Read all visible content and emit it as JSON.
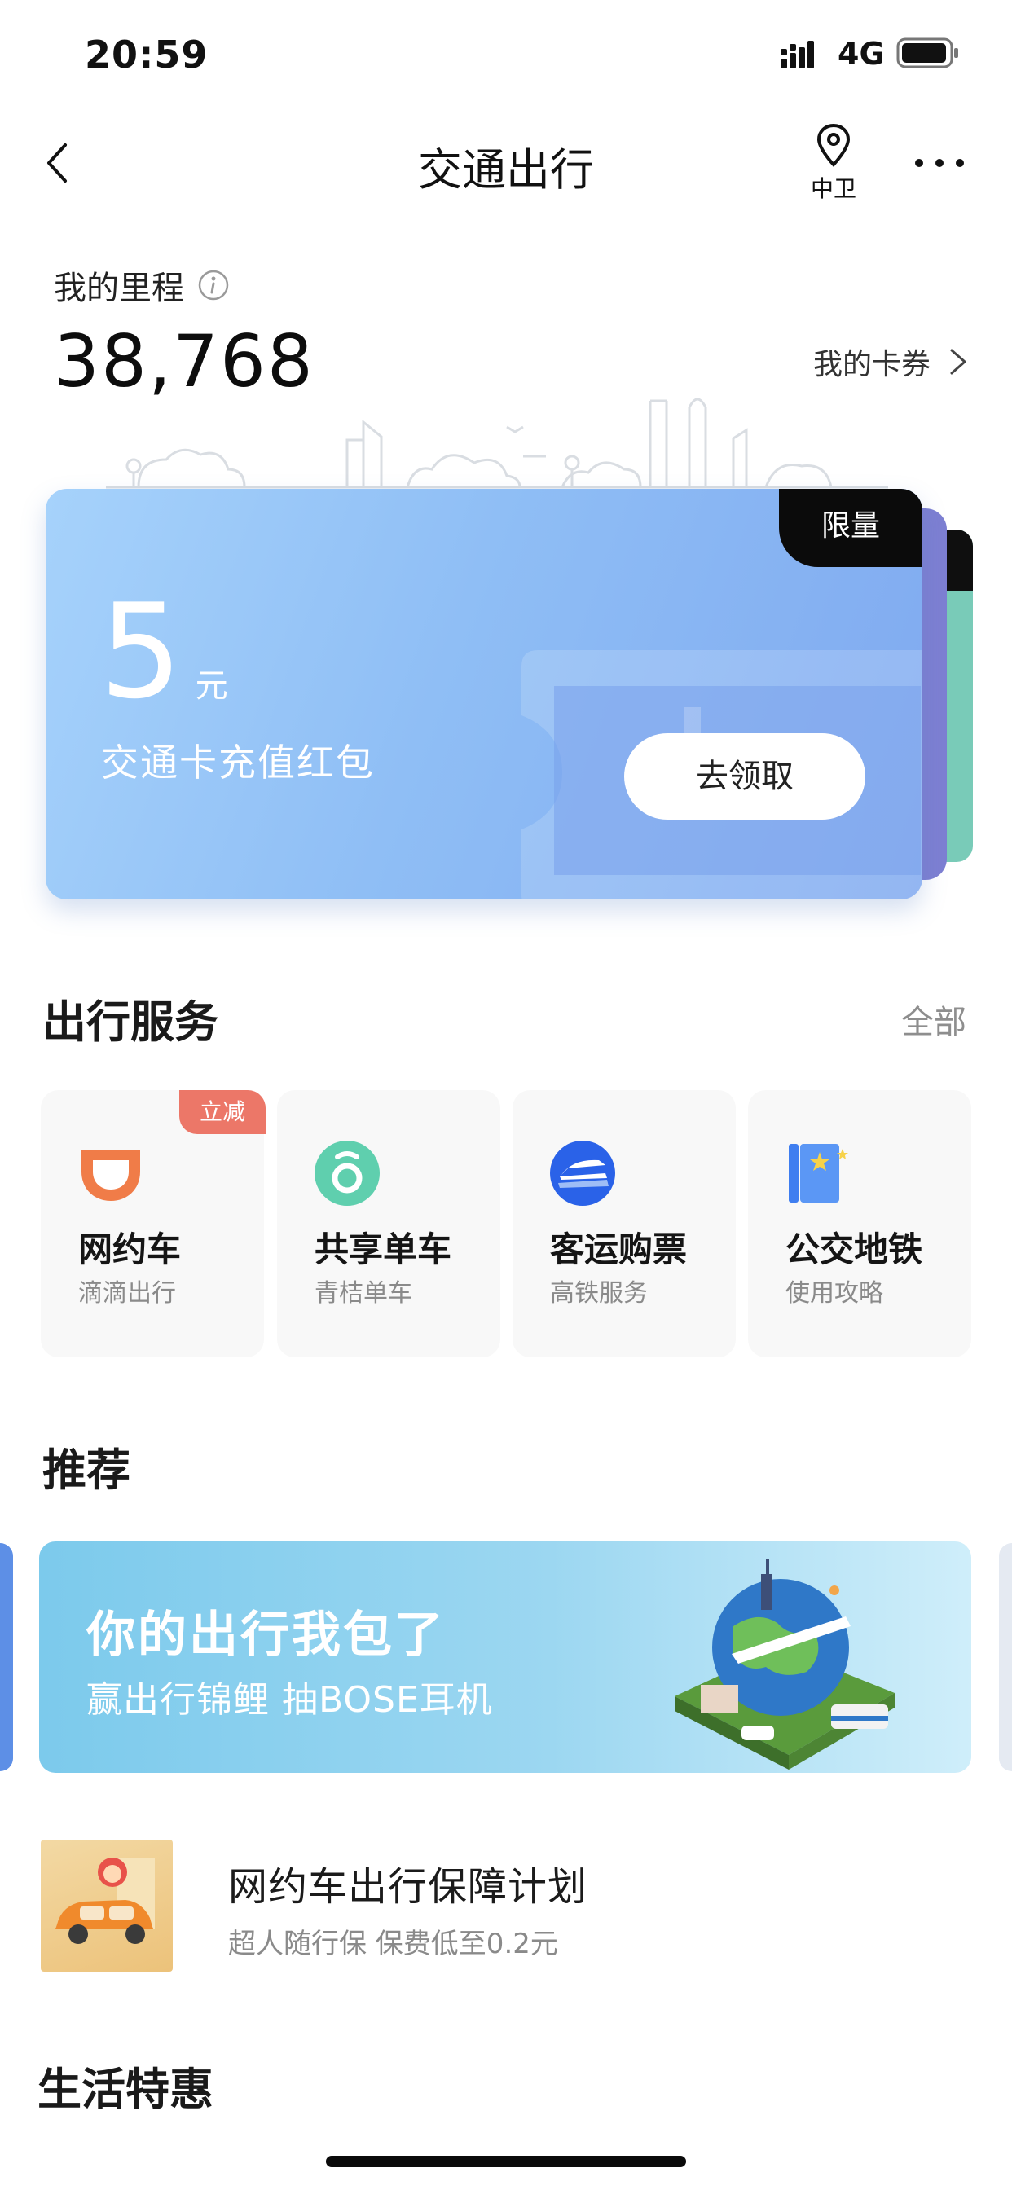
{
  "status_bar": {
    "time": "20:59",
    "network": "4G"
  },
  "nav": {
    "title": "交通出行",
    "location": "中卫"
  },
  "mileage": {
    "label": "我的里程",
    "value": "38,768",
    "coupons_label": "我的卡券"
  },
  "coupon": {
    "badge": "限量",
    "amount": "5",
    "unit": "元",
    "description": "交通卡充值红包",
    "button": "去领取"
  },
  "services": {
    "title": "出行服务",
    "all_label": "全部",
    "items": [
      {
        "name": "网约车",
        "sub": "滴滴出行",
        "badge": "立减",
        "icon": "didi-icon"
      },
      {
        "name": "共享单车",
        "sub": "青桔单车",
        "icon": "bike-icon"
      },
      {
        "name": "客运购票",
        "sub": "高铁服务",
        "icon": "train-ticket-icon"
      },
      {
        "name": "公交地铁",
        "sub": "使用攻略",
        "icon": "transit-guide-icon"
      }
    ]
  },
  "recommend": {
    "title": "推荐",
    "banner_title": "你的出行我包了",
    "banner_sub": "赢出行锦鲤 抽BOSE耳机"
  },
  "insurance": {
    "title": "网约车出行保障计划",
    "sub": "超人随行保 保费低至0.2元"
  },
  "life": {
    "title": "生活特惠"
  },
  "colors": {
    "coupon_gradient_start": "#a6d2fb",
    "coupon_gradient_end": "#7fa9f0",
    "badge_red": "#ec7768",
    "didi_orange": "#f07c48",
    "bike_green": "#5fcfae",
    "train_blue": "#2a62e8"
  }
}
